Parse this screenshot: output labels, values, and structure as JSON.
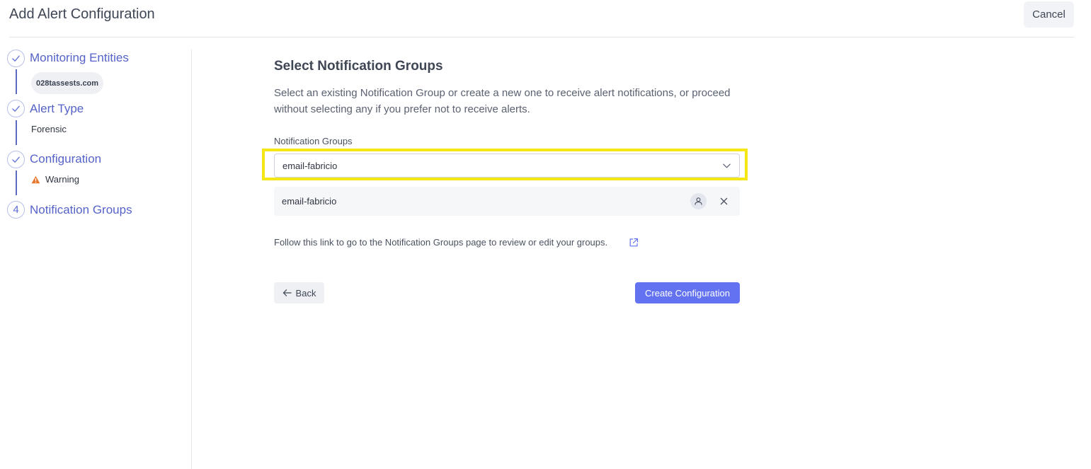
{
  "header": {
    "title": "Add Alert Configuration",
    "cancel_label": "Cancel"
  },
  "stepper": {
    "steps": [
      {
        "label": "Monitoring Entities",
        "status": "complete",
        "icon": "check-icon",
        "detail": "028tassests.com"
      },
      {
        "label": "Alert Type",
        "status": "complete",
        "icon": "check-icon",
        "detail": "Forensic"
      },
      {
        "label": "Configuration",
        "status": "complete",
        "icon": "check-icon",
        "detail": "Warning"
      },
      {
        "label": "Notification Groups",
        "status": "current",
        "number": "4"
      }
    ]
  },
  "main": {
    "title": "Select Notification Groups",
    "description": "Select an existing Notification Group or create a new one to receive alert notifications, or proceed without selecting any if you prefer not to receive alerts.",
    "field_label": "Notification Groups",
    "select_value": "email-fabricio",
    "selected_groups": [
      {
        "name": "email-fabricio",
        "icon": "person-icon"
      }
    ],
    "follow_text": "Follow this link to go to the Notification Groups page to review or edit your groups.",
    "back_label": "Back",
    "create_label": "Create Configuration"
  },
  "colors": {
    "accent": "#6272f0",
    "step_text": "#5563c9",
    "highlight": "#f5e616",
    "warning": "#e8762b"
  }
}
